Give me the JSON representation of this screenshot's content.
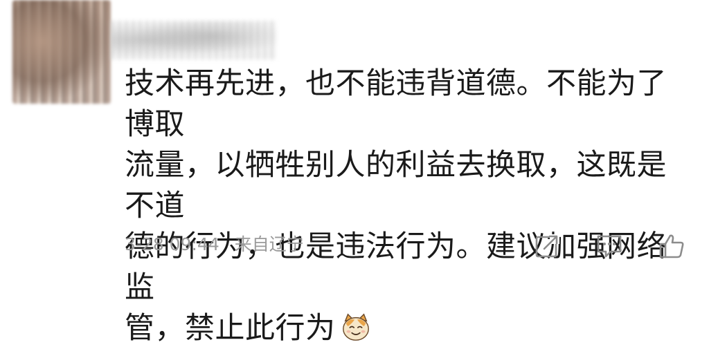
{
  "comment": {
    "lines": [
      "技术再先进，也不能违背道德。不能为了博取",
      "流量，以牺牲别人的利益去换取，这既是不道",
      "德的行为，也是违法行为。建议加强网络监",
      "管，禁止此行为"
    ],
    "emoji": "cat-face-icon"
  },
  "meta": {
    "datetime": "3-28 09:44",
    "location": "来自辽宁"
  },
  "actions": {
    "repost_icon": "share-icon",
    "comment_icon": "comment-icon",
    "like_icon": "thumbs-up-icon"
  },
  "colors": {
    "text": "#1a1a1a",
    "meta": "#9a9a9a",
    "icon": "#8c8c8c"
  }
}
